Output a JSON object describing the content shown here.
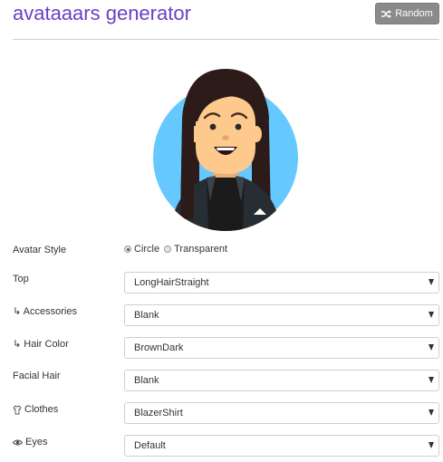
{
  "app": {
    "title": "avataaars generator",
    "random_label": "Random"
  },
  "colors": {
    "title": "#6a3fc8",
    "avatar_circle": "#65c9ff",
    "skin": "#fdc98c",
    "hair": "#2c1b18",
    "blazer": "#262e33",
    "button_bg": "#8a8a8a"
  },
  "form": {
    "avatar_style": {
      "label": "Avatar Style",
      "options": [
        "Circle",
        "Transparent"
      ],
      "selected": "Circle"
    },
    "rows": [
      {
        "label": "Top",
        "icon": "",
        "value": "LongHairStraight"
      },
      {
        "label": "↳ Accessories",
        "icon": "glasses-icon",
        "value": "Blank"
      },
      {
        "label": "↳ Hair Color",
        "icon": "hair-color-icon",
        "value": "BrownDark"
      },
      {
        "label": "Facial Hair",
        "icon": "",
        "value": "Blank"
      },
      {
        "label": "Clothes",
        "icon": "shirt-icon",
        "value": "BlazerShirt"
      },
      {
        "label": "Eyes",
        "icon": "eye-icon",
        "value": "Default"
      }
    ]
  }
}
